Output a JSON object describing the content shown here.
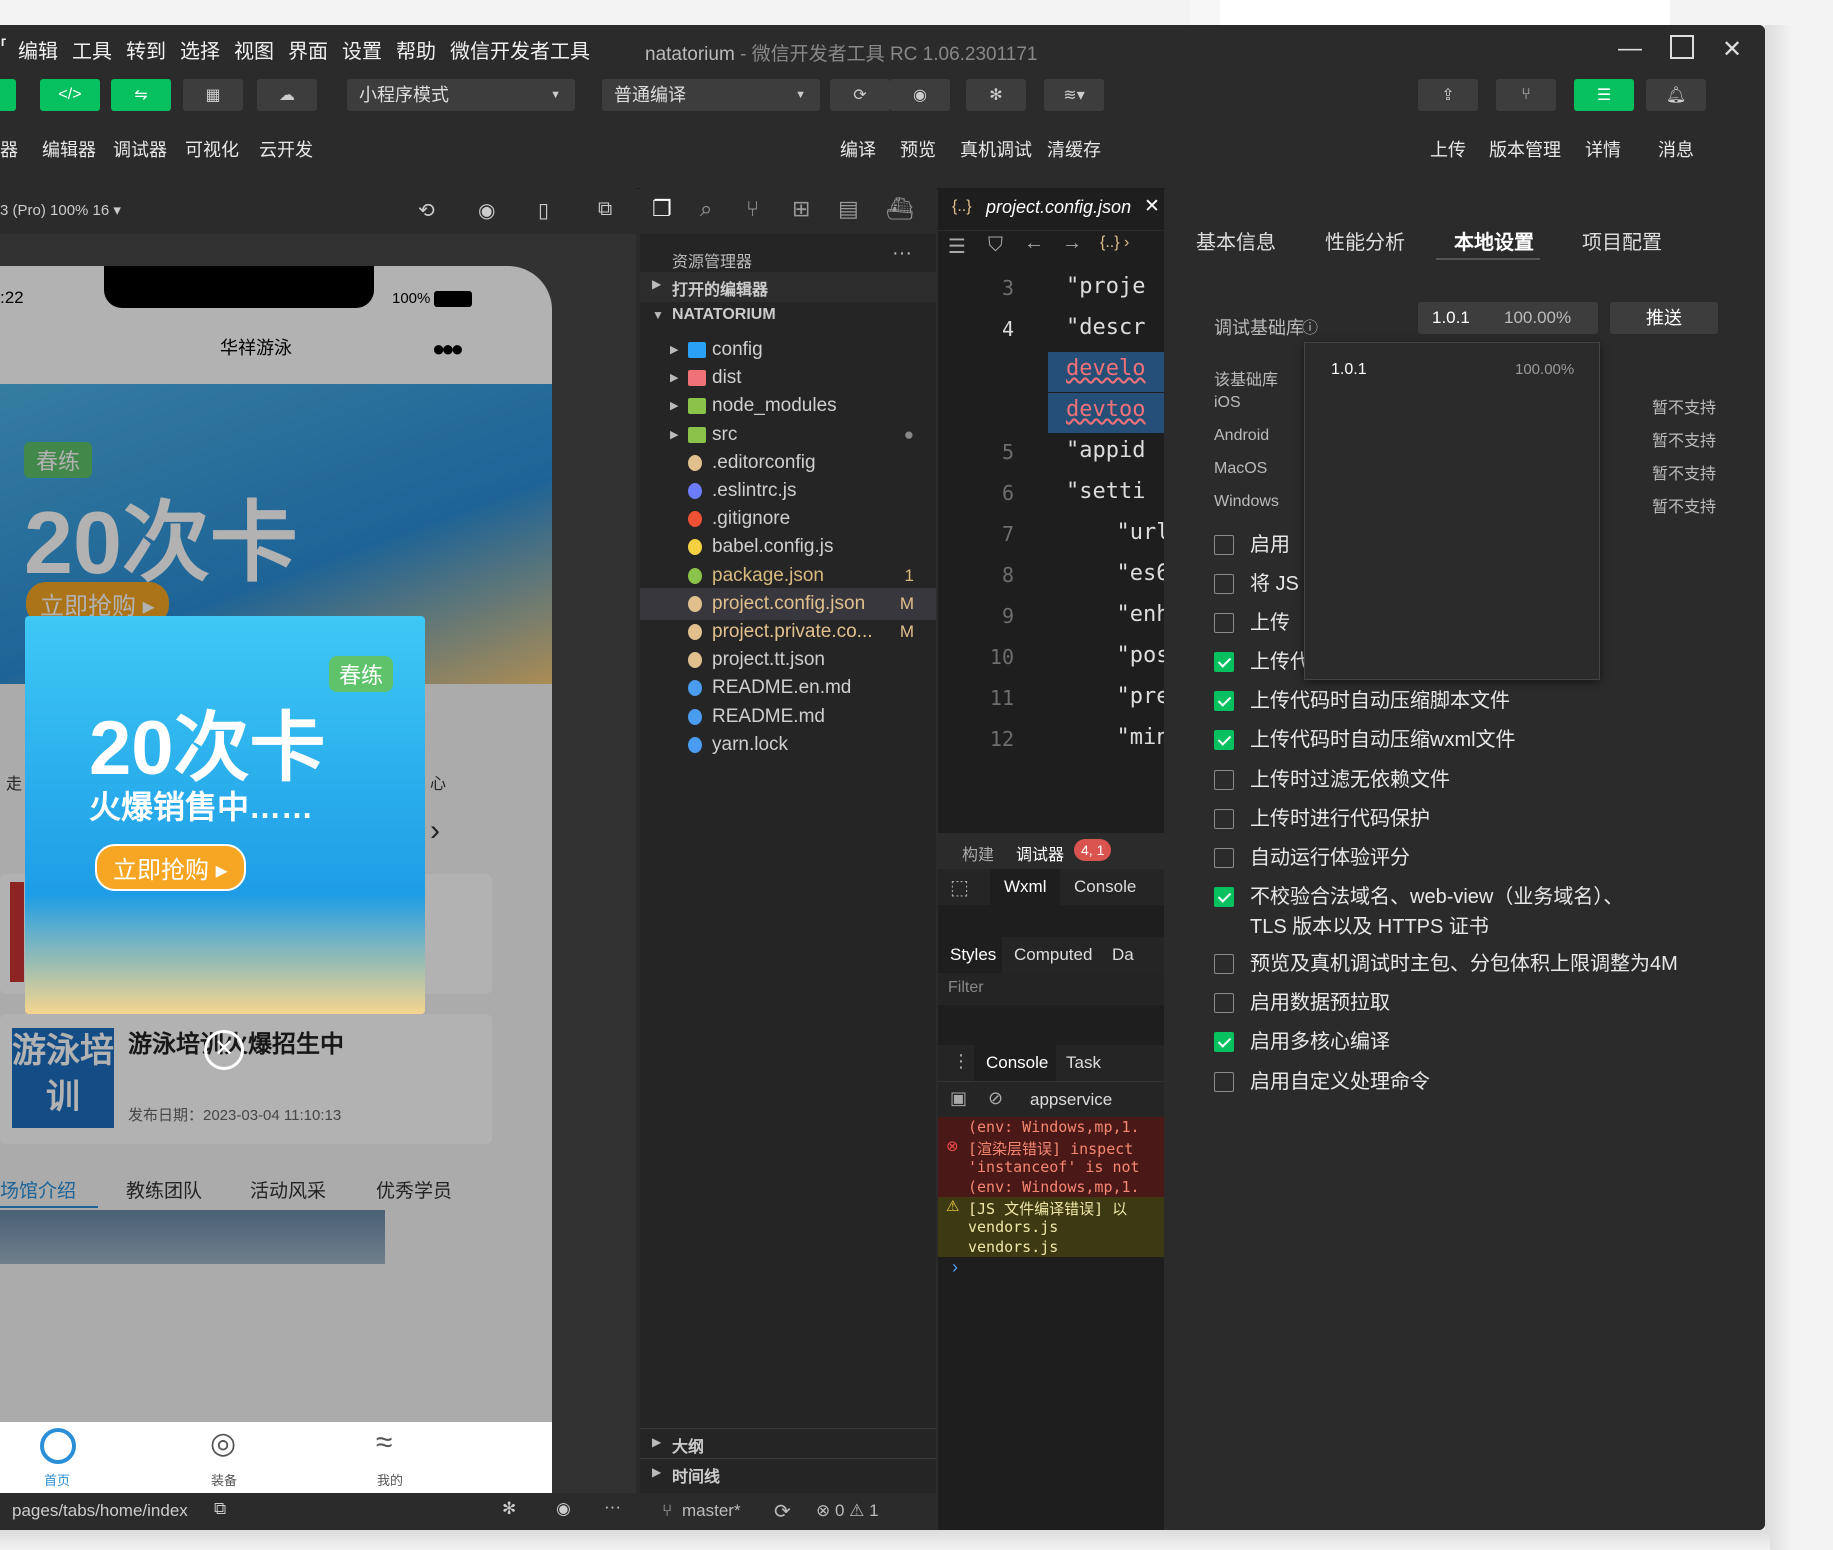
{
  "app": {
    "menu": [
      "编辑",
      "工具",
      "转到",
      "选择",
      "视图",
      "界面",
      "设置",
      "帮助",
      "微信开发者工具"
    ],
    "project_name": "natatorium",
    "window_subtitle": "- 微信开发者工具 RC 1.06.2301171"
  },
  "toolbar": {
    "left_labels": [
      "器",
      "编辑器",
      "调试器",
      "可视化",
      "云开发"
    ],
    "mode_select": "小程序模式",
    "compile_select": "普通编译",
    "mid_labels": [
      "编译",
      "预览",
      "真机调试",
      "清缓存"
    ],
    "right_labels": [
      "上传",
      "版本管理",
      "详情",
      "消息"
    ]
  },
  "simulator": {
    "device": "3 (Pro) 100% 16 ▾",
    "time": ":22",
    "battery": "100%",
    "page_title": "华祥游泳",
    "banner_badge": "春练",
    "banner_title": "20次卡",
    "banner_btn": "立即抢购 ▸",
    "popup_badge": "春练",
    "popup_title": "20次卡",
    "popup_sub": "火爆销售中……",
    "popup_btn": "立即抢购",
    "nav_left": "走",
    "nav_right": "心",
    "news_title": "游泳培训火爆招生中",
    "news_img_text": "游泳培训",
    "news_date": "发布日期：2023-03-04 11:10:13",
    "tabs": [
      "场馆介绍",
      "教练团队",
      "活动风采",
      "优秀学员"
    ],
    "tabbar": [
      "首页",
      "装备",
      "我的"
    ],
    "path": "pages/tabs/home/index"
  },
  "explorer": {
    "title": "资源管理器",
    "open_editors": "打开的编辑器",
    "root": "NATATORIUM",
    "items": [
      {
        "name": "config",
        "badge": "",
        "color": "#cfcfcf"
      },
      {
        "name": "dist",
        "badge": "",
        "color": "#cfcfcf"
      },
      {
        "name": "node_modules",
        "badge": "",
        "color": "#cfcfcf"
      },
      {
        "name": "src",
        "badge": "●",
        "color": "#cfcfcf"
      },
      {
        "name": ".editorconfig",
        "badge": "",
        "color": "#cfcfcf"
      },
      {
        "name": ".eslintrc.js",
        "badge": "",
        "color": "#cfcfcf"
      },
      {
        "name": ".gitignore",
        "badge": "",
        "color": "#cfcfcf"
      },
      {
        "name": "babel.config.js",
        "badge": "",
        "color": "#cfcfcf"
      },
      {
        "name": "package.json",
        "badge": "1",
        "color": "#d7ba7d"
      },
      {
        "name": "project.config.json",
        "badge": "M",
        "color": "#e2c08d"
      },
      {
        "name": "project.private.co...",
        "badge": "M",
        "color": "#e2c08d"
      },
      {
        "name": "project.tt.json",
        "badge": "",
        "color": "#cfcfcf"
      },
      {
        "name": "README.en.md",
        "badge": "",
        "color": "#cfcfcf"
      },
      {
        "name": "README.md",
        "badge": "",
        "color": "#cfcfcf"
      },
      {
        "name": "yarn.lock",
        "badge": "",
        "color": "#cfcfcf"
      }
    ],
    "outline": "大纲",
    "timeline": "时间线",
    "branch": "master*",
    "problems": "⊗ 0 ⚠ 1"
  },
  "editor": {
    "tab": "project.config.json",
    "lines": [
      {
        "n": "3",
        "t": "\"proje"
      },
      {
        "n": "4",
        "t": "\"descr"
      },
      {
        "n": "",
        "t": "develo"
      },
      {
        "n": "",
        "t": "devtoo"
      },
      {
        "n": "5",
        "t": "\"appid"
      },
      {
        "n": "6",
        "t": "\"setti"
      },
      {
        "n": "7",
        "t": "  \"url"
      },
      {
        "n": "8",
        "t": "  \"es6"
      },
      {
        "n": "9",
        "t": "  \"enh"
      },
      {
        "n": "10",
        "t": "  \"pos"
      },
      {
        "n": "11",
        "t": "  \"pre"
      },
      {
        "n": "12",
        "t": "  \"min"
      }
    ]
  },
  "debugger": {
    "tabs": [
      "构建",
      "调试器"
    ],
    "badge": "4, 1",
    "panel_tabs": [
      "Wxml",
      "Console"
    ],
    "style_tabs": [
      "Styles",
      "Computed",
      "Da"
    ],
    "filter": "Filter",
    "drawer_tabs": [
      "Console",
      "Task"
    ],
    "context": "appservice",
    "log": [
      {
        "type": "err",
        "text": "(env: Windows,mp,1."
      },
      {
        "type": "err",
        "text": "[渲染层错误] inspect"
      },
      {
        "type": "err",
        "text": "'instanceof' is not"
      },
      {
        "type": "err",
        "text": "(env: Windows,mp,1."
      },
      {
        "type": "warn",
        "text": "[JS 文件编译错误] 以"
      },
      {
        "type": "warn",
        "text": "vendors.js"
      },
      {
        "type": "warn",
        "text": "vendors.js"
      }
    ]
  },
  "settings": {
    "tabs": [
      "基本信息",
      "性能分析",
      "本地设置",
      "项目配置"
    ],
    "active_tab": "本地设置",
    "lib_label": "调试基础库",
    "lib_version": "1.0.1",
    "lib_percent": "100.00%",
    "push_btn": "推送",
    "lib_desc": "该基础库",
    "dropdown_version": "1.0.1",
    "dropdown_percent": "100.00%",
    "os_rows": [
      {
        "os": "iOS",
        "status": "暂不支持"
      },
      {
        "os": "Android",
        "status": "暂不支持"
      },
      {
        "os": "MacOS",
        "status": "暂不支持"
      },
      {
        "os": "Windows",
        "status": "暂不支持"
      }
    ],
    "options": [
      {
        "label": "启用",
        "checked": false
      },
      {
        "label": "将 JS",
        "checked": false
      },
      {
        "label": "上传",
        "checked": false
      },
      {
        "label": "上传代码时自动压缩样式文件",
        "checked": true
      },
      {
        "label": "上传代码时自动压缩脚本文件",
        "checked": true
      },
      {
        "label": "上传代码时自动压缩wxml文件",
        "checked": true
      },
      {
        "label": "上传时过滤无依赖文件",
        "checked": false
      },
      {
        "label": "上传时进行代码保护",
        "checked": false
      },
      {
        "label": "自动运行体验评分",
        "checked": false
      },
      {
        "label": "不校验合法域名、web-view（业务域名）、TLS 版本以及 HTTPS 证书",
        "checked": true
      },
      {
        "label": "预览及真机调试时主包、分包体积上限调整为4M",
        "checked": false
      },
      {
        "label": "启用数据预拉取",
        "checked": false
      },
      {
        "label": "启用多核心编译",
        "checked": true
      },
      {
        "label": "启用自定义处理命令",
        "checked": false
      }
    ]
  }
}
